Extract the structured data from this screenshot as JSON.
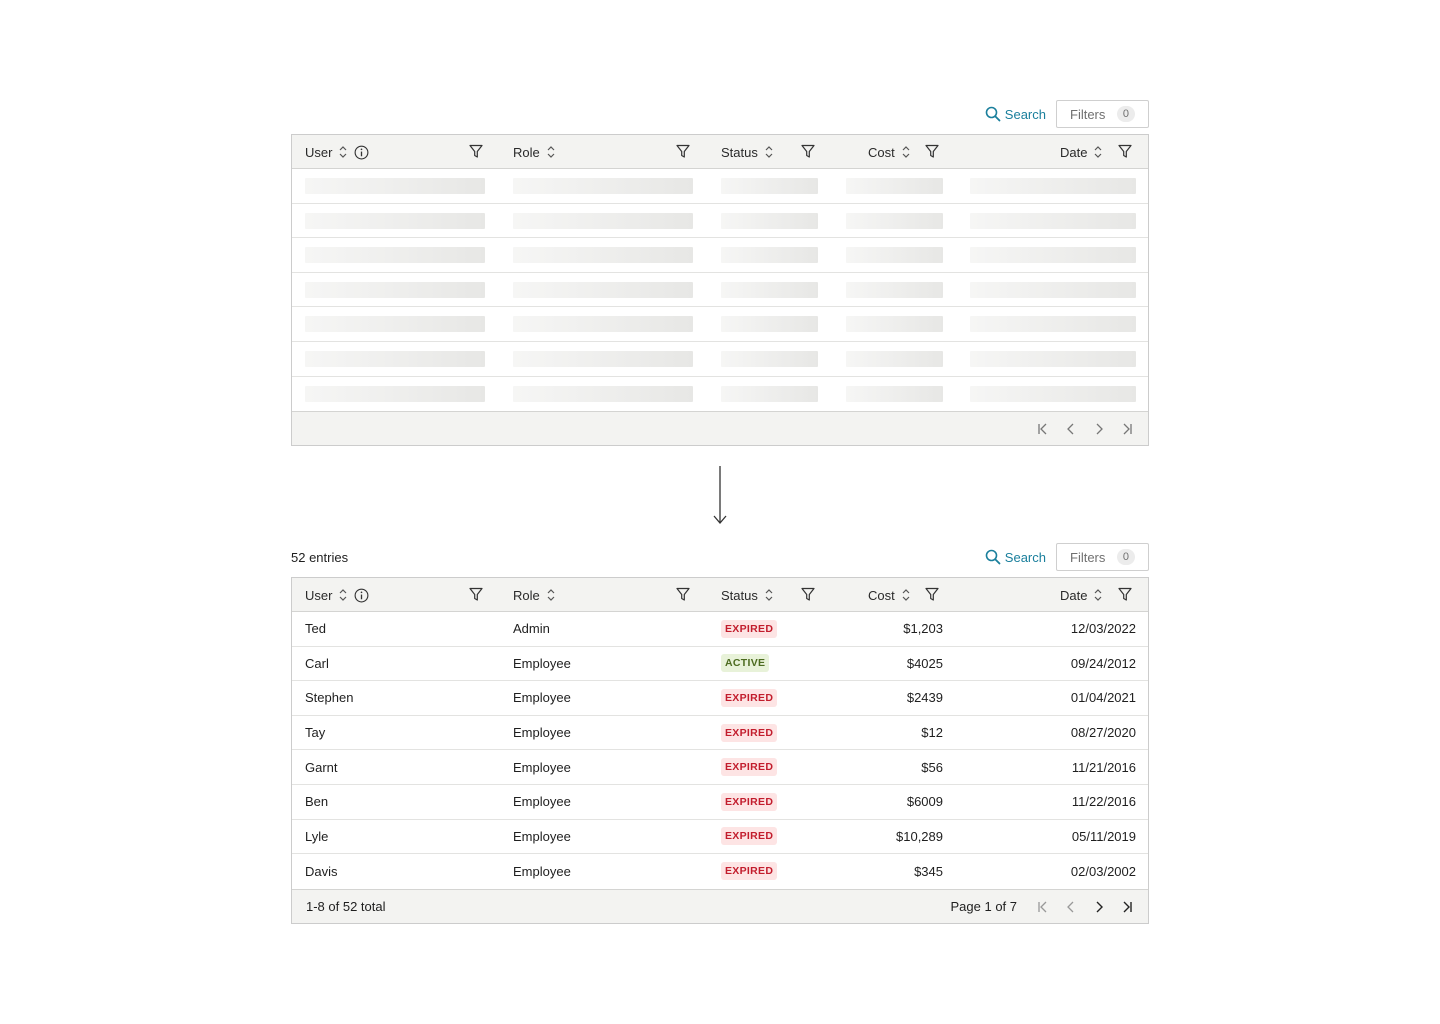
{
  "search_label": "Search",
  "filters_label": "Filters",
  "filters_count": "0",
  "columns": [
    "User",
    "Role",
    "Status",
    "Cost",
    "Date"
  ],
  "loading_rows": 7,
  "loaded": {
    "entries_label": "52 entries",
    "rows": [
      {
        "user": "Ted",
        "role": "Admin",
        "status": "EXPIRED",
        "cost": "$1,203",
        "date": "12/03/2022"
      },
      {
        "user": "Carl",
        "role": "Employee",
        "status": "ACTIVE",
        "cost": "$4025",
        "date": "09/24/2012"
      },
      {
        "user": "Stephen",
        "role": "Employee",
        "status": "EXPIRED",
        "cost": "$2439",
        "date": "01/04/2021"
      },
      {
        "user": "Tay",
        "role": "Employee",
        "status": "EXPIRED",
        "cost": "$12",
        "date": "08/27/2020"
      },
      {
        "user": "Garnt",
        "role": "Employee",
        "status": "EXPIRED",
        "cost": "$56",
        "date": "11/21/2016"
      },
      {
        "user": "Ben",
        "role": "Employee",
        "status": "EXPIRED",
        "cost": "$6009",
        "date": "11/22/2016"
      },
      {
        "user": "Lyle",
        "role": "Employee",
        "status": "EXPIRED",
        "cost": "$10,289",
        "date": "05/11/2019"
      },
      {
        "user": "Davis",
        "role": "Employee",
        "status": "EXPIRED",
        "cost": "$345",
        "date": "02/03/2002"
      }
    ],
    "footer_total": "1-8 of 52 total",
    "footer_page": "Page 1 of 7"
  },
  "colors": {
    "accent": "#1a7f9c",
    "expired_bg": "#fde4e4",
    "expired_fg": "#c21d2d",
    "active_bg": "#e8f2d9",
    "active_fg": "#4c6b1f"
  }
}
